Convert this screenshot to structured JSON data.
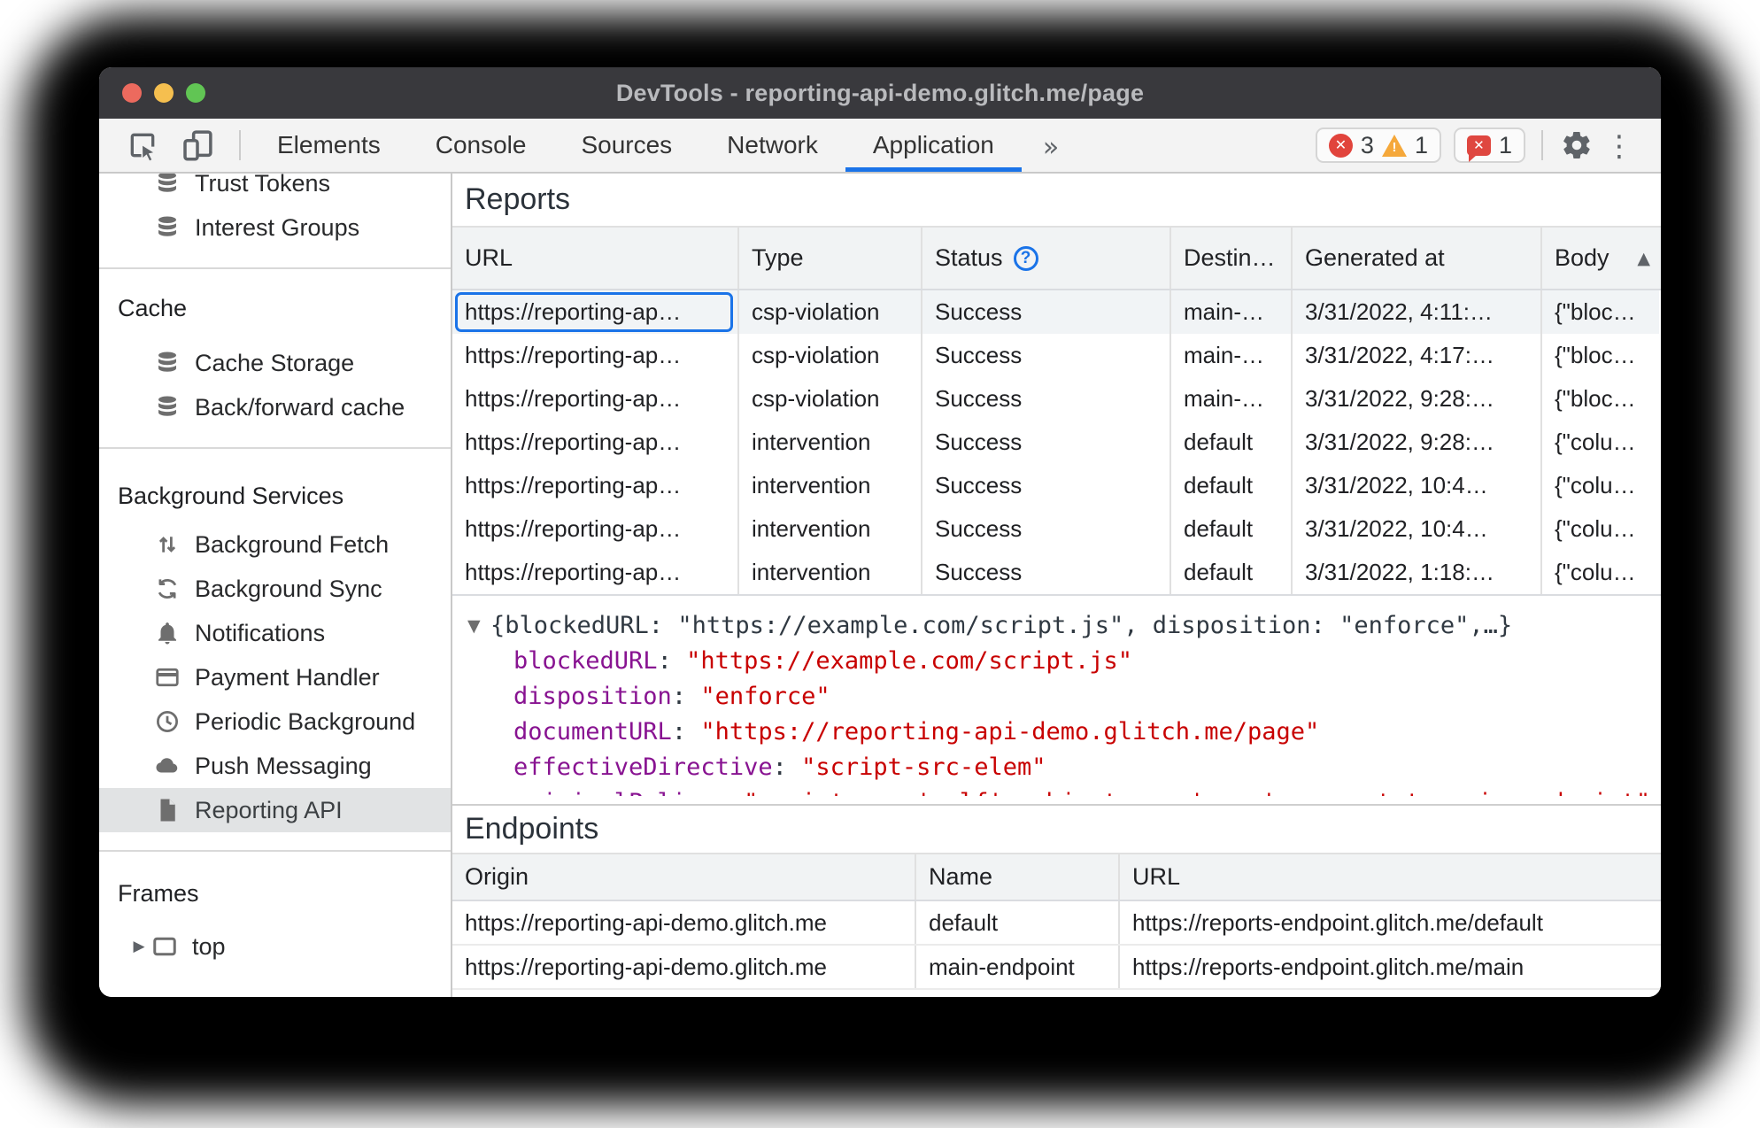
{
  "window": {
    "title": "DevTools - reporting-api-demo.glitch.me/page"
  },
  "toolbar": {
    "tabs": [
      {
        "label": "Elements"
      },
      {
        "label": "Console"
      },
      {
        "label": "Sources"
      },
      {
        "label": "Network"
      },
      {
        "label": "Application",
        "active": true
      }
    ],
    "badges": {
      "errors": "3",
      "warnings": "1",
      "issues": "1"
    }
  },
  "icons": {
    "more_tabs": "»",
    "overflow_menu": "⋮",
    "json_expander": "▼",
    "frame_expander": "▶",
    "sort_ascending": "▲",
    "status_help": "?",
    "error_x": "✕",
    "issues_x": "✕",
    "warning_mark": "!"
  },
  "colors": {
    "accent_blue": "#1a73e8",
    "error_red": "#e1443c",
    "warning_yellow": "#f5a83a",
    "issues_red": "#df4740",
    "titlebar": "#39393d",
    "traffic_red": "#ec6a5e",
    "traffic_yellow": "#f5bf4f",
    "traffic_green": "#61c554",
    "json_key": "#881391",
    "json_string": "#c80000"
  },
  "sidebar": {
    "sections": [
      {
        "header": "",
        "items": [
          {
            "label": "Trust Tokens",
            "icon": "database-icon"
          },
          {
            "label": "Interest Groups",
            "icon": "database-icon"
          }
        ]
      },
      {
        "header": "Cache",
        "items": [
          {
            "label": "Cache Storage",
            "icon": "database-icon"
          },
          {
            "label": "Back/forward cache",
            "icon": "database-icon"
          }
        ]
      },
      {
        "header": "Background Services",
        "items": [
          {
            "label": "Background Fetch",
            "icon": "up-down-arrows-icon"
          },
          {
            "label": "Background Sync",
            "icon": "sync-icon"
          },
          {
            "label": "Notifications",
            "icon": "bell-icon"
          },
          {
            "label": "Payment Handler",
            "icon": "card-icon"
          },
          {
            "label": "Periodic Background",
            "icon": "clock-icon"
          },
          {
            "label": "Push Messaging",
            "icon": "cloud-icon"
          },
          {
            "label": "Reporting API",
            "icon": "document-icon",
            "selected": true
          }
        ]
      },
      {
        "header": "Frames",
        "items": [
          {
            "label": "top",
            "icon": "frame-icon"
          }
        ]
      }
    ]
  },
  "reports": {
    "title": "Reports",
    "columns": [
      "URL",
      "Type",
      "Status",
      "Destin…",
      "Generated at",
      "Body"
    ],
    "rows": [
      {
        "url": "https://reporting-ap…",
        "type": "csp-violation",
        "status": "Success",
        "destination": "main-…",
        "generated_at": "3/31/2022, 4:11:…",
        "body": "{\"bloc…",
        "selected": true
      },
      {
        "url": "https://reporting-ap…",
        "type": "csp-violation",
        "status": "Success",
        "destination": "main-…",
        "generated_at": "3/31/2022, 4:17:…",
        "body": "{\"bloc…"
      },
      {
        "url": "https://reporting-ap…",
        "type": "csp-violation",
        "status": "Success",
        "destination": "main-…",
        "generated_at": "3/31/2022, 9:28:…",
        "body": "{\"bloc…"
      },
      {
        "url": "https://reporting-ap…",
        "type": "intervention",
        "status": "Success",
        "destination": "default",
        "generated_at": "3/31/2022, 9:28:…",
        "body": "{\"colu…"
      },
      {
        "url": "https://reporting-ap…",
        "type": "intervention",
        "status": "Success",
        "destination": "default",
        "generated_at": "3/31/2022, 10:4…",
        "body": "{\"colu…"
      },
      {
        "url": "https://reporting-ap…",
        "type": "intervention",
        "status": "Success",
        "destination": "default",
        "generated_at": "3/31/2022, 10:4…",
        "body": "{\"colu…"
      },
      {
        "url": "https://reporting-ap…",
        "type": "intervention",
        "status": "Success",
        "destination": "default",
        "generated_at": "3/31/2022, 1:18:…",
        "body": "{\"colu…"
      }
    ]
  },
  "report_detail": {
    "preview": "{blockedURL: \"https://example.com/script.js\", disposition: \"enforce\",…}",
    "properties": [
      {
        "key": "blockedURL",
        "value": "\"https://example.com/script.js\""
      },
      {
        "key": "disposition",
        "value": "\"enforce\""
      },
      {
        "key": "documentURL",
        "value": "\"https://reporting-api-demo.glitch.me/page\""
      },
      {
        "key": "effectiveDirective",
        "value": "\"script-src-elem\""
      },
      {
        "key": "originalPolicy",
        "value": "\"script-src 'self'; object-src 'none'; report-to main-endpoint\""
      }
    ]
  },
  "endpoints": {
    "title": "Endpoints",
    "columns": [
      "Origin",
      "Name",
      "URL"
    ],
    "rows": [
      {
        "origin": "https://reporting-api-demo.glitch.me",
        "name": "default",
        "url": "https://reports-endpoint.glitch.me/default"
      },
      {
        "origin": "https://reporting-api-demo.glitch.me",
        "name": "main-endpoint",
        "url": "https://reports-endpoint.glitch.me/main"
      }
    ]
  }
}
